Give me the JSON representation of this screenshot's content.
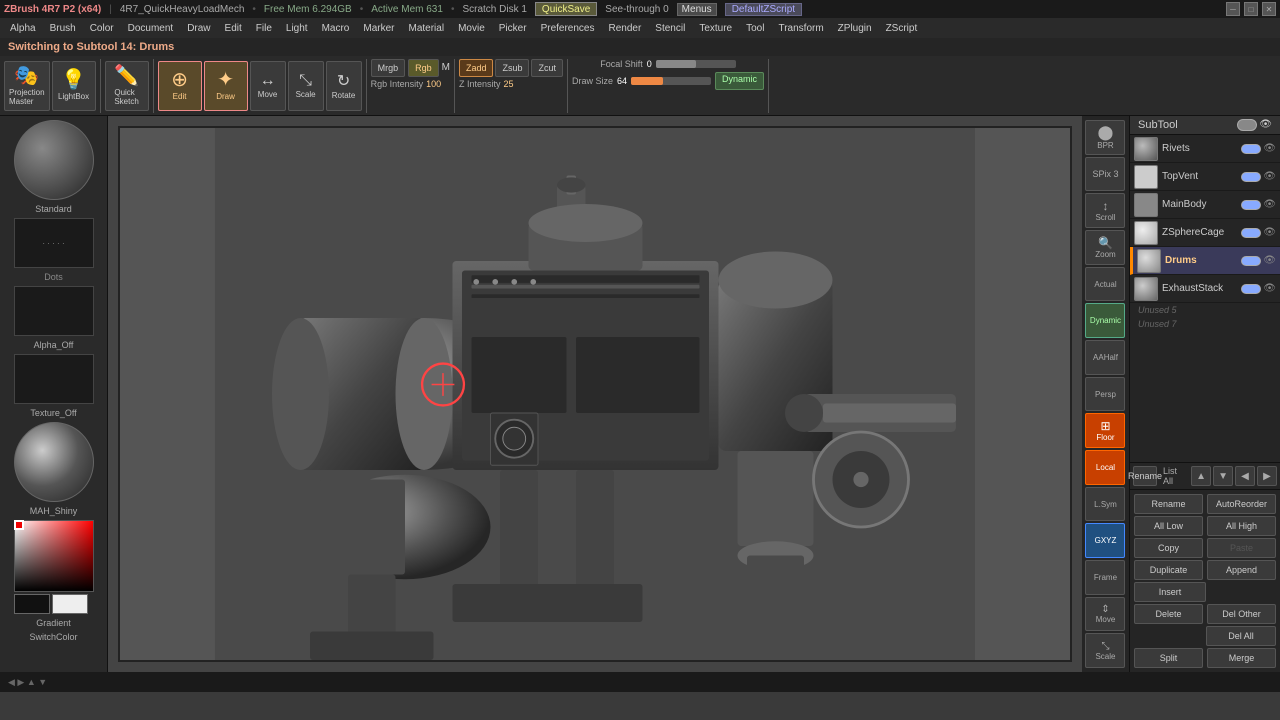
{
  "topbar": {
    "app_title": "ZBrush 4R7 P2 (x64)",
    "file_name": "4R7_QuickHeavyLoadMech",
    "free_mem": "Free Mem 6.294GB",
    "active_mem": "Active Mem 631",
    "scratch_disk": "Scratch Disk 1",
    "quicksave": "QuickSave",
    "seethrough": "See-through 0",
    "menus": "Menus",
    "default_zscript": "DefaultZScript"
  },
  "menubar": {
    "items": [
      "Alpha",
      "Brush",
      "Color",
      "Document",
      "Draw",
      "Edit",
      "File",
      "Light",
      "Macro",
      "Marker",
      "Material",
      "Movie",
      "Picker",
      "Preferences",
      "Render",
      "Stencil",
      "Texture",
      "Tool",
      "Transform",
      "ZPlugin",
      "ZScript"
    ]
  },
  "notifbar": {
    "text": "Switching to Subtool 14:  Drums"
  },
  "toolbar": {
    "projection_master": "Projection\nMaster",
    "lightbox": "LightBox",
    "quick_sketch": "Quick\nSketch",
    "edit": "Edit",
    "draw": "Draw",
    "move_label": "Move",
    "scale_label": "Scale",
    "rotate_label": "Rotate",
    "mrgb": "Mrgb",
    "rgb": "Rgb",
    "m_label": "M",
    "zadd": "Zadd",
    "zsub": "Zsub",
    "zcut": "Zcut",
    "rgb_intensity": "Rgb Intensity",
    "rgb_intensity_val": "100",
    "z_intensity": "Z Intensity",
    "z_intensity_val": "25",
    "focal_shift": "Focal Shift",
    "focal_shift_val": "0",
    "draw_size": "Draw Size",
    "draw_size_val": "64",
    "dynamic": "Dynamic"
  },
  "left_panel": {
    "brush_name": "Standard",
    "dots_label": "Dots",
    "alpha_label": "Alpha_Off",
    "texture_label": "Texture_Off",
    "material_label": "MAH_Shiny",
    "gradient_label": "Gradient",
    "switchcolor_label": "SwitchColor"
  },
  "viewport_controls": {
    "bpr_label": "BPR",
    "spix_label": "SPix 3",
    "scroll_label": "Scroll",
    "zoom_label": "Zoom",
    "actual_label": "Actual",
    "dynamic_label": "Dynamic",
    "aahalf_label": "AAHalf",
    "persp_label": "Persp",
    "floor_label": "Floor",
    "local_label": "Local",
    "lsym_label": "L.Sym",
    "gxyz_label": "GXYZ",
    "frame_label": "Frame",
    "move_label": "Move",
    "scale_label": "Scale"
  },
  "subtool": {
    "header": "SubTool",
    "items": [
      {
        "name": "Rivets",
        "active": false,
        "toggle_on": true
      },
      {
        "name": "TopVent",
        "active": false,
        "toggle_on": true
      },
      {
        "name": "MainBody",
        "active": false,
        "toggle_on": true
      },
      {
        "name": "ZSphereCage",
        "active": false,
        "toggle_on": true
      },
      {
        "name": "Drums",
        "active": true,
        "toggle_on": true
      },
      {
        "name": "ExhaustStack",
        "active": false,
        "toggle_on": true
      }
    ],
    "unused_5": "Unused  5",
    "unused_7": "Unused  7"
  },
  "subtool_actions": {
    "rename": "Rename",
    "auto_reorder": "AutoReorder",
    "all_low": "All Low",
    "all_high": "All High",
    "copy": "Copy",
    "paste": "Paste",
    "duplicate": "Duplicate",
    "append": "Append",
    "insert": "Insert",
    "delete": "Delete",
    "del_other": "Del Other",
    "del_all": "Del All",
    "split": "Split",
    "merge": "Merge"
  },
  "bottombar": {
    "nav_arrows": [
      "◀",
      "▶",
      "▲",
      "▼"
    ]
  }
}
